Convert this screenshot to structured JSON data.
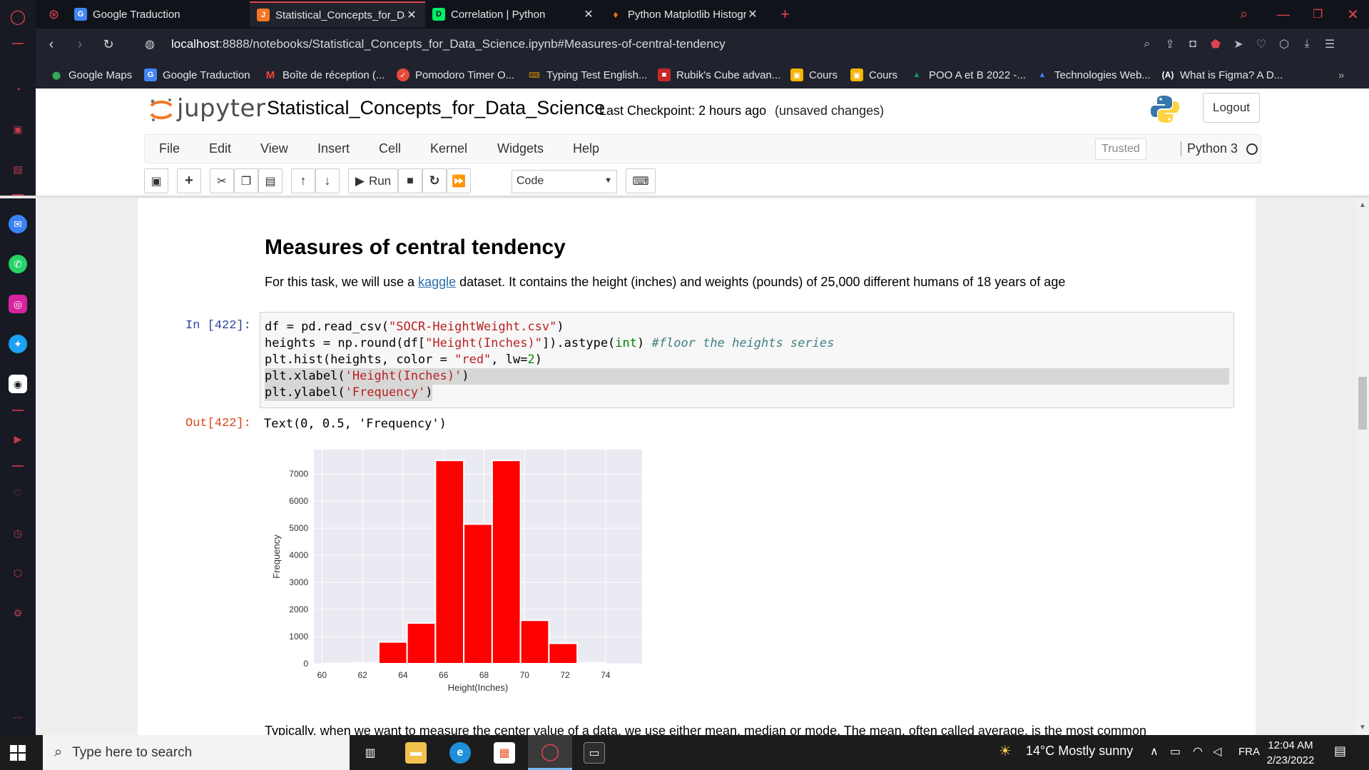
{
  "browser": {
    "tabs": [
      {
        "title": "Google Traduction",
        "favicon": "google-translate-icon",
        "color": "#4285f4",
        "active": false
      },
      {
        "title": "Statistical_Concepts_for_Da",
        "favicon": "jupyter-icon",
        "color": "#f37626",
        "active": true
      },
      {
        "title": "Correlation | Python",
        "favicon": "datacamp-icon",
        "color": "#03ef62",
        "active": false
      },
      {
        "title": "Python Matplotlib Histogra",
        "favicon": "document-icon",
        "color": "#e8710a",
        "active": false
      }
    ],
    "url_host": "localhost",
    "url_rest": ":8888/notebooks/Statistical_Concepts_for_Data_Science.ipynb#Measures-of-central-tendency",
    "bookmarks": [
      {
        "label": "Google Maps",
        "icon": "map-pin-icon",
        "color": "#34a853"
      },
      {
        "label": "Google Traduction",
        "icon": "google-translate-icon",
        "color": "#4285f4"
      },
      {
        "label": "Boîte de réception (...",
        "icon": "gmail-icon",
        "color": "#ea4335"
      },
      {
        "label": "Pomodoro Timer O...",
        "icon": "check-circle-icon",
        "color": "#e84a3b"
      },
      {
        "label": "Typing Test English...",
        "icon": "keyboard-icon",
        "color": "#c28b00"
      },
      {
        "label": "Rubik's Cube advan...",
        "icon": "cube-icon",
        "color": "#c62828"
      },
      {
        "label": "Cours",
        "icon": "classroom-icon",
        "color": "#f4b400"
      },
      {
        "label": "Cours",
        "icon": "classroom-icon",
        "color": "#f4b400"
      },
      {
        "label": "POO A et B 2022 -...",
        "icon": "drive-icon",
        "color": "#0f9d58"
      },
      {
        "label": "Technologies Web...",
        "icon": "drive-icon",
        "color": "#4285f4"
      },
      {
        "label": "What is Figma? A D...",
        "icon": "text-icon",
        "color": "#20232d"
      }
    ]
  },
  "jupyter": {
    "logo_text": "jupyter",
    "notebook_name": "Statistical_Concepts_for_Data_Science",
    "checkpoint": "Last Checkpoint: 2 hours ago",
    "unsaved": "(unsaved changes)",
    "logout": "Logout",
    "menu": [
      "File",
      "Edit",
      "View",
      "Insert",
      "Cell",
      "Kernel",
      "Widgets",
      "Help"
    ],
    "trusted": "Trusted",
    "kernel": "Python 3",
    "run_label": "Run",
    "cell_type": "Code"
  },
  "notebook": {
    "heading": "Measures of central tendency",
    "para_before": "For this task, we will use a ",
    "para_link": "kaggle",
    "para_after": " dataset. It contains the height (inches) and weights (pounds) of 25,000 different humans of 18 years of age",
    "in_prompt": "In [422]:",
    "out_prompt": "Out[422]:",
    "output_text": "Text(0, 0.5, 'Frequency')",
    "bottom_text": "Typically, when we want to measure the center value of a data, we use either mean, median or mode. The mean, often called average, is the most common"
  },
  "code": {
    "l1a": "df = pd.read_csv(",
    "l1b": "\"SOCR-HeightWeight.csv\"",
    "l1c": ")",
    "l2a": "heights = np.round(df[",
    "l2b": "\"Height(Inches)\"",
    "l2c": "]).astype(",
    "l2d": "int",
    "l2e": ") ",
    "l2f": "#floor the heights series",
    "l3a": "plt.hist(heights, color = ",
    "l3b": "\"red\"",
    "l3c": ", lw=",
    "l3d": "2",
    "l3e": ")",
    "l4a": "plt.xlabel(",
    "l4b": "'Height(Inches)'",
    "l4c": ")",
    "l5a": "plt.ylabel(",
    "l5b": "'Frequency'",
    "l5c": ")"
  },
  "chart_data": {
    "type": "bar",
    "xlabel": "Height(Inches)",
    "ylabel": "Frequency",
    "xlim": [
      59.6,
      75.8
    ],
    "ylim": [
      0,
      7900
    ],
    "xticks": [
      60,
      62,
      64,
      66,
      68,
      70,
      72,
      74
    ],
    "yticks": [
      0,
      1000,
      2000,
      3000,
      4000,
      5000,
      6000,
      7000
    ],
    "bins": [
      {
        "x0": 60.0,
        "x1": 61.4,
        "count": 5
      },
      {
        "x0": 61.4,
        "x1": 62.8,
        "count": 30
      },
      {
        "x0": 62.8,
        "x1": 64.2,
        "count": 800
      },
      {
        "x0": 64.2,
        "x1": 65.6,
        "count": 1500
      },
      {
        "x0": 65.6,
        "x1": 67.0,
        "count": 7500
      },
      {
        "x0": 67.0,
        "x1": 68.4,
        "count": 5150
      },
      {
        "x0": 68.4,
        "x1": 69.8,
        "count": 7500
      },
      {
        "x0": 69.8,
        "x1": 71.2,
        "count": 1600
      },
      {
        "x0": 71.2,
        "x1": 72.6,
        "count": 750
      },
      {
        "x0": 72.6,
        "x1": 74.0,
        "count": 30
      }
    ],
    "bar_color": "#ff0000",
    "background": "#eaeaf2",
    "grid": true
  },
  "taskbar": {
    "search_placeholder": "Type here to search",
    "weather": "14°C  Mostly sunny",
    "lang": "FRA",
    "time": "12:04 AM",
    "date": "2/23/2022"
  }
}
